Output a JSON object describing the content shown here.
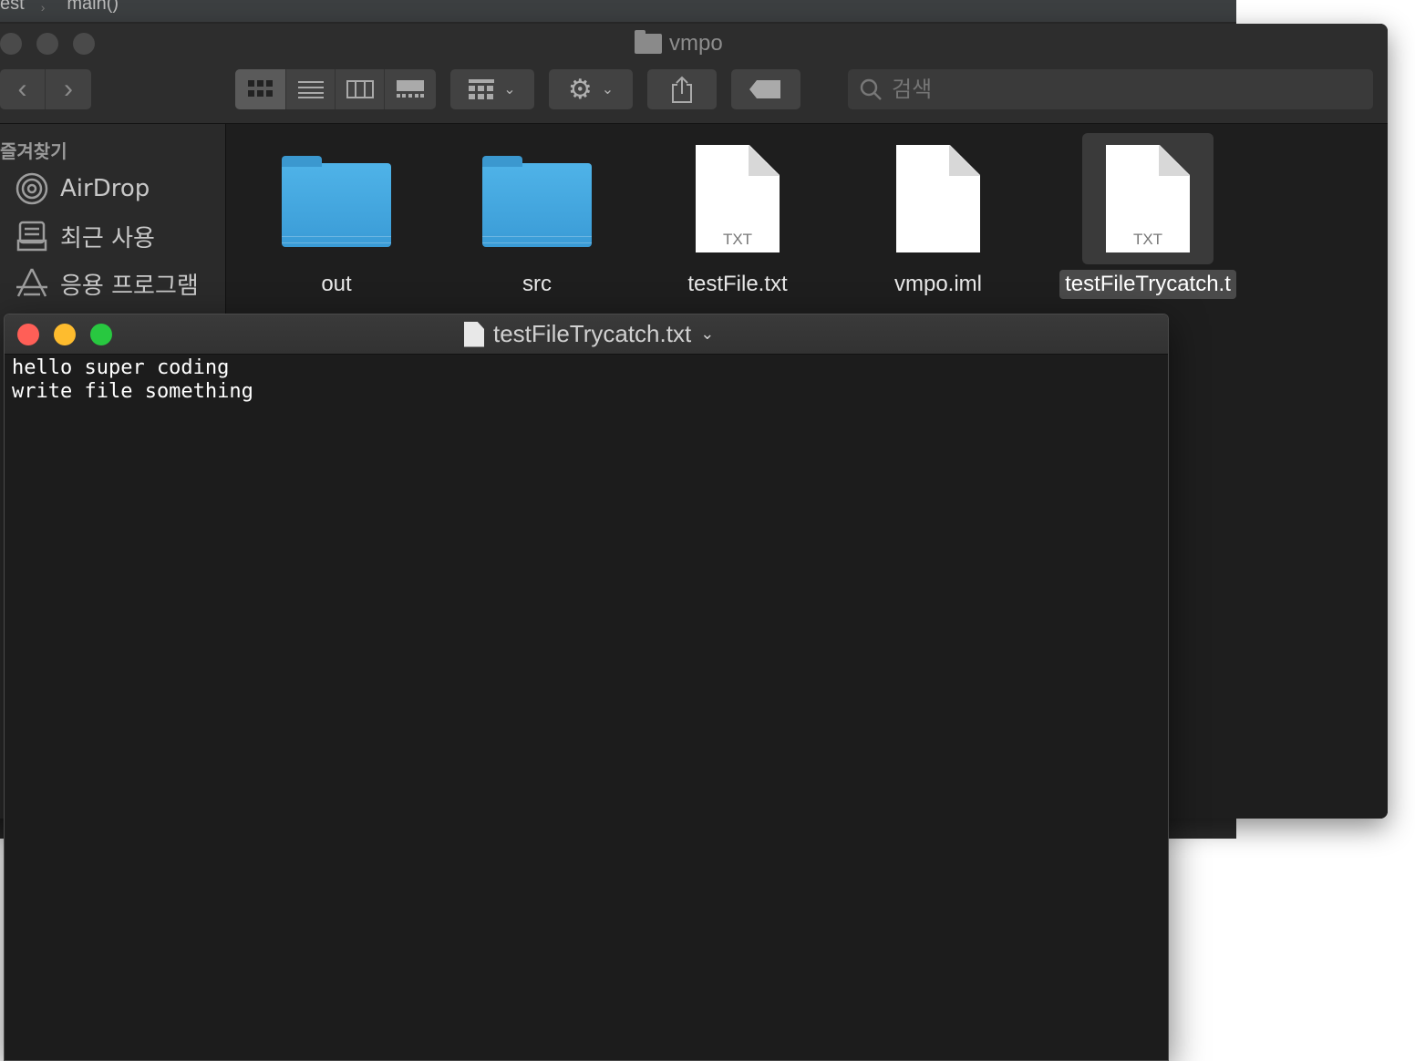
{
  "ide": {
    "breadcrumb": [
      "est",
      "main()"
    ]
  },
  "finder": {
    "title": "vmpo",
    "search_placeholder": "검색",
    "sidebar": {
      "heading": "즐겨찾기",
      "items": [
        {
          "label": "AirDrop",
          "icon": "airdrop-icon"
        },
        {
          "label": "최근 사용",
          "icon": "recents-icon"
        },
        {
          "label": "응용 프로그램",
          "icon": "applications-icon"
        }
      ]
    },
    "files": [
      {
        "name": "out",
        "type": "folder"
      },
      {
        "name": "src",
        "type": "folder"
      },
      {
        "name": "testFile.txt",
        "type": "txt",
        "badge": "TXT"
      },
      {
        "name": "vmpo.iml",
        "type": "doc"
      },
      {
        "name": "testFileTrycatch.t",
        "type": "txt",
        "badge": "TXT",
        "selected": true
      }
    ]
  },
  "textedit": {
    "title": "testFileTrycatch.txt",
    "lines": [
      "hello super coding",
      "write file something"
    ]
  },
  "colors": {
    "close": "#ff5f57",
    "minimize": "#febc2e",
    "zoom": "#28c840",
    "folder": "#4fb3e8"
  }
}
